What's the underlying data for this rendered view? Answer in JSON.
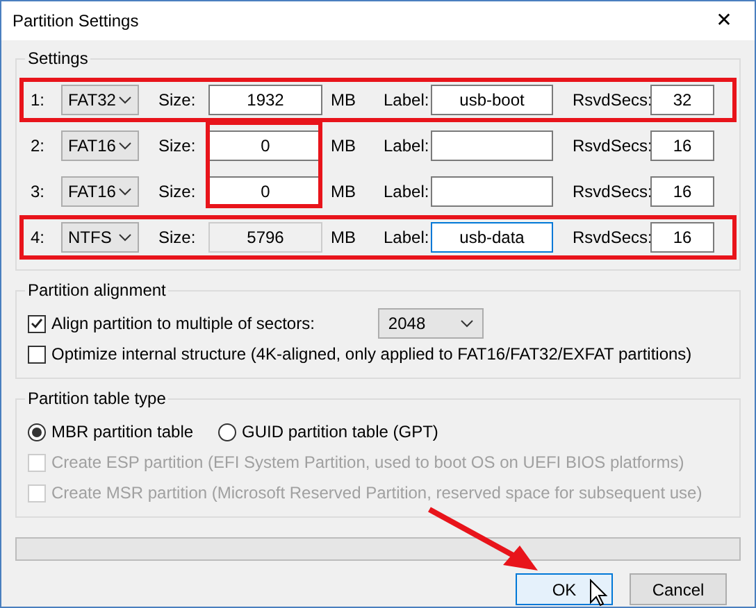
{
  "window": {
    "title": "Partition Settings",
    "close": "✕"
  },
  "settings": {
    "title": "Settings",
    "rows": [
      {
        "number": "1:",
        "fs": "FAT32",
        "size_label": "Size:",
        "size": "1932",
        "size_disabled": false,
        "unit": "MB",
        "label_label": "Label:",
        "label": "usb-boot",
        "label_focused": false,
        "rsvd_label": "RsvdSecs:",
        "rsvd": "32",
        "highlighted": true
      },
      {
        "number": "2:",
        "fs": "FAT16",
        "size_label": "Size:",
        "size": "0",
        "size_disabled": false,
        "unit": "MB",
        "label_label": "Label:",
        "label": "",
        "label_focused": false,
        "rsvd_label": "RsvdSecs:",
        "rsvd": "16",
        "highlighted": false
      },
      {
        "number": "3:",
        "fs": "FAT16",
        "size_label": "Size:",
        "size": "0",
        "size_disabled": false,
        "unit": "MB",
        "label_label": "Label:",
        "label": "",
        "label_focused": false,
        "rsvd_label": "RsvdSecs:",
        "rsvd": "16",
        "highlighted": false
      },
      {
        "number": "4:",
        "fs": "NTFS",
        "size_label": "Size:",
        "size": "5796",
        "size_disabled": true,
        "unit": "MB",
        "label_label": "Label:",
        "label": "usb-data",
        "label_focused": true,
        "rsvd_label": "RsvdSecs:",
        "rsvd": "16",
        "highlighted": true
      }
    ],
    "size_box_highlighted": true
  },
  "alignment": {
    "title": "Partition alignment",
    "align": {
      "label": "Align partition to multiple of sectors:",
      "checked": true,
      "value": "2048"
    },
    "optimize": {
      "label": "Optimize internal structure (4K-aligned, only applied to FAT16/FAT32/EXFAT partitions)",
      "checked": false
    }
  },
  "table_type": {
    "title": "Partition table type",
    "options": [
      {
        "label": "MBR partition table",
        "selected": true
      },
      {
        "label": "GUID partition table (GPT)",
        "selected": false
      }
    ],
    "checks": [
      {
        "label": "Create ESP partition (EFI System Partition, used to boot OS on UEFI BIOS platforms)",
        "checked": false,
        "disabled": true
      },
      {
        "label": "Create MSR partition (Microsoft Reserved Partition, reserved space for subsequent use)",
        "checked": false,
        "disabled": true
      }
    ]
  },
  "buttons": [
    {
      "label": "OK",
      "default": true
    },
    {
      "label": "Cancel",
      "default": false
    }
  ],
  "arrow_to_ok": true
}
